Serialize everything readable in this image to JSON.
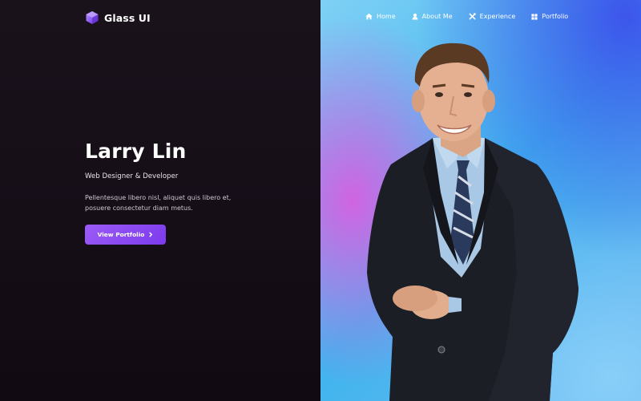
{
  "brand": {
    "name": "Glass UI",
    "icon": "cube-icon"
  },
  "nav": {
    "items": [
      {
        "label": "Home",
        "icon": "home-icon"
      },
      {
        "label": "About Me",
        "icon": "user-icon"
      },
      {
        "label": "Experience",
        "icon": "tools-icon"
      },
      {
        "label": "Portfolio",
        "icon": "grid-icon"
      }
    ]
  },
  "hero": {
    "name": "Larry Lin",
    "role": "Web Designer & Developer",
    "description": "Pellentesque libero nisl, aliquet quis libero et, posuere consectetur diam metus.",
    "button_label": "View Portfolio",
    "button_icon": "chevron-right-icon"
  },
  "colors": {
    "accent": "#8b4cf0",
    "left_background": "#170f18",
    "right_background": "#3fb5ee"
  }
}
